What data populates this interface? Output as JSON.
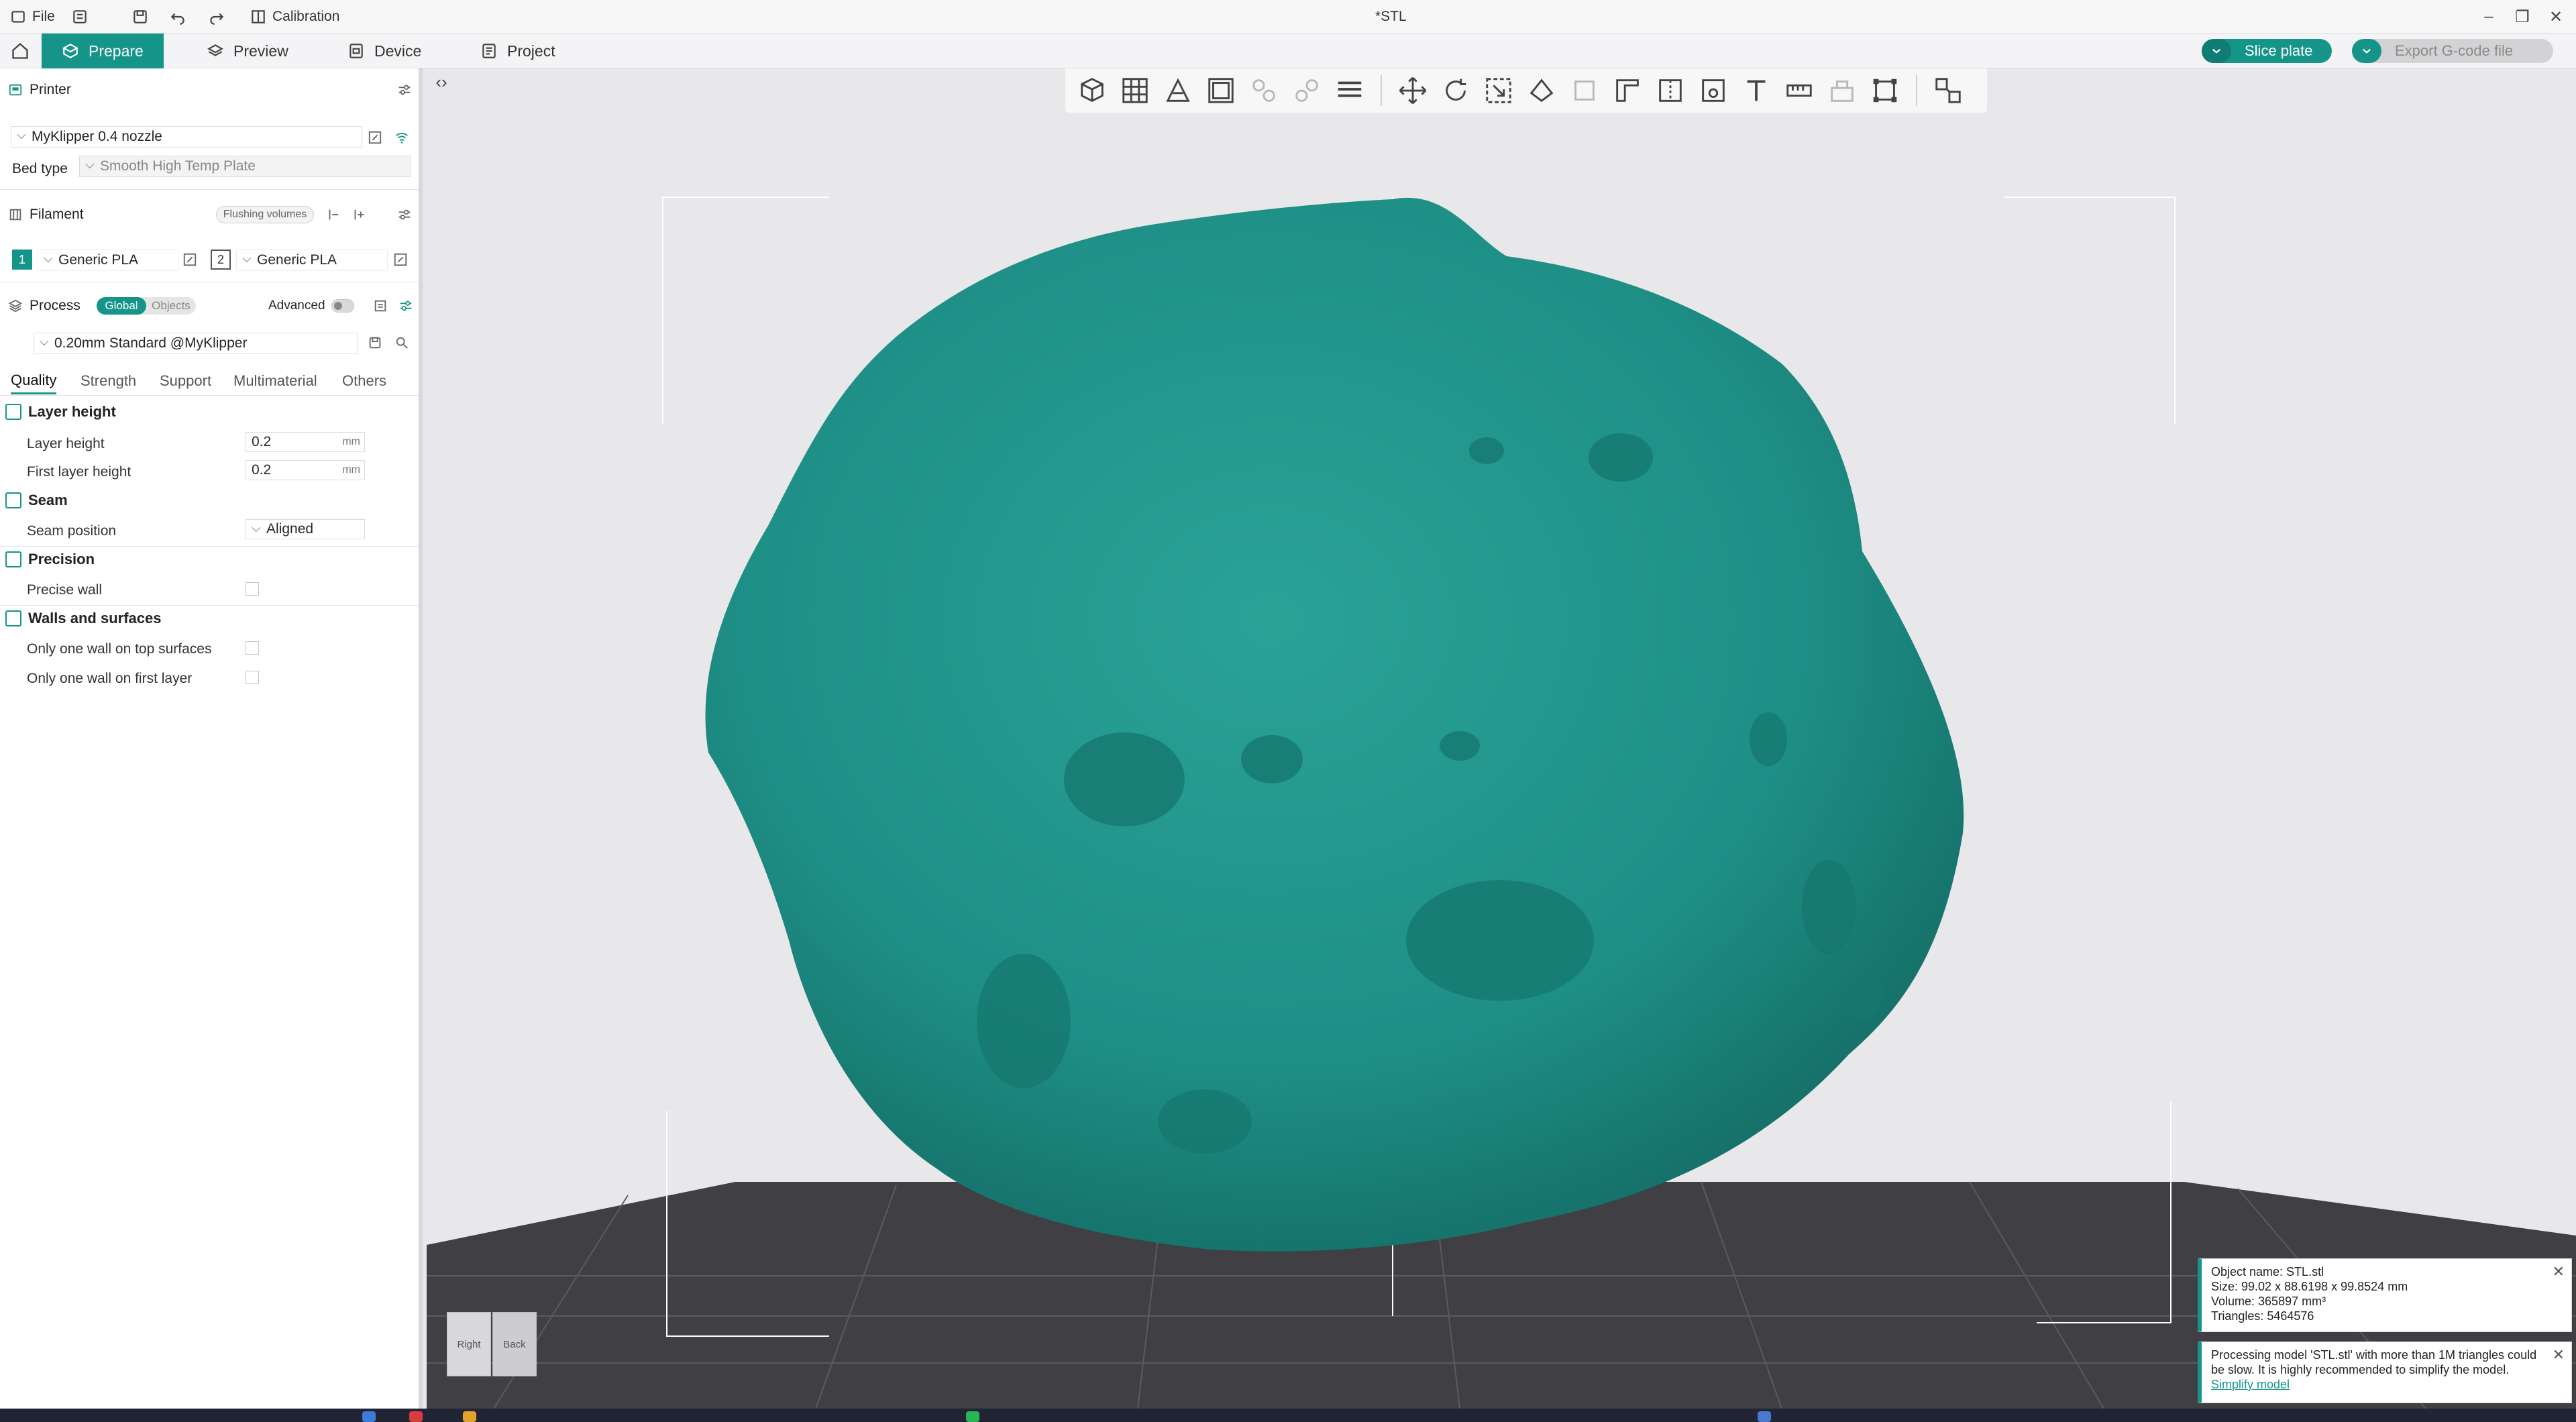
{
  "titlebar": {
    "file_label": "File",
    "calibration_label": "Calibration",
    "window_title": "*STL"
  },
  "tabs": {
    "prepare": "Prepare",
    "preview": "Preview",
    "device": "Device",
    "project": "Project"
  },
  "actions": {
    "slice_plate": "Slice plate",
    "export_gcode": "Export G-code file"
  },
  "printer": {
    "section_label": "Printer",
    "name": "MyKlipper 0.4 nozzle",
    "bed_type_label": "Bed type",
    "bed_type_value": "Smooth High Temp Plate"
  },
  "filament": {
    "section_label": "Filament",
    "flushing_label": "Flushing volumes",
    "slots": [
      {
        "index": "1",
        "name": "Generic PLA"
      },
      {
        "index": "2",
        "name": "Generic PLA"
      }
    ]
  },
  "process": {
    "section_label": "Process",
    "global_label": "Global",
    "objects_label": "Objects",
    "advanced_label": "Advanced",
    "preset": "0.20mm Standard @MyKlipper"
  },
  "quality_tabs": [
    "Quality",
    "Strength",
    "Support",
    "Multimaterial",
    "Others"
  ],
  "groups": {
    "layer_height": {
      "title": "Layer height",
      "layer_height_label": "Layer height",
      "layer_height_value": "0.2",
      "first_layer_label": "First layer height",
      "first_layer_value": "0.2",
      "unit": "mm"
    },
    "seam": {
      "title": "Seam",
      "position_label": "Seam position",
      "position_value": "Aligned"
    },
    "precision": {
      "title": "Precision",
      "precise_wall_label": "Precise wall"
    },
    "walls": {
      "title": "Walls and surfaces",
      "top_label": "Only one wall on top surfaces",
      "first_label": "Only one wall on first layer"
    }
  },
  "viewcube": {
    "right": "Right",
    "back": "Back"
  },
  "object_info": {
    "name": "Object name: STL.stl",
    "size": "Size: 99.02 x 88.6198 x 99.8524 mm",
    "volume": "Volume: 365897 mm³",
    "triangles": "Triangles: 5464576"
  },
  "processing_notice": {
    "text": "Processing model 'STL.stl' with more than 1M triangles could be slow. It is highly recommended to simplify the model.",
    "link": "Simplify model"
  },
  "colors": {
    "accent": "#15958a",
    "model": "#1e8f86",
    "plate": "#3f3f44"
  }
}
